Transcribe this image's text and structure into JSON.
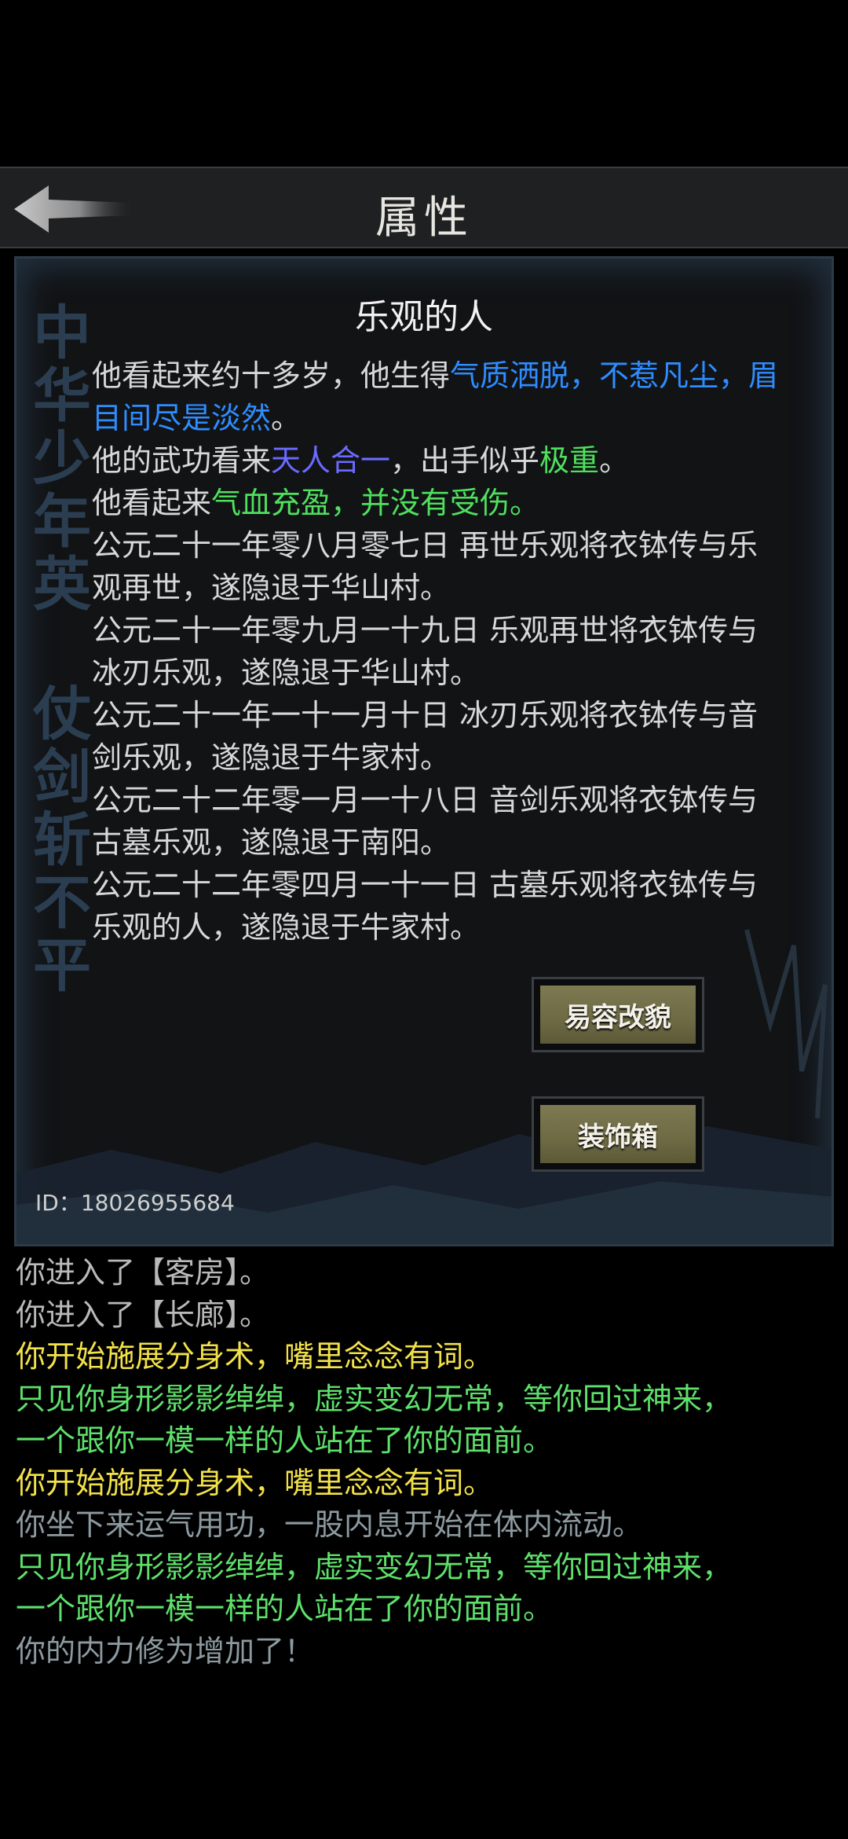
{
  "header": {
    "title": "属性",
    "back_icon": "back-arrow-icon"
  },
  "panel": {
    "calligraphy_left": "中华少年英",
    "calligraphy_right": "仗剑斩不平",
    "character_name": "乐观的人",
    "bio": [
      [
        {
          "text": "他看起来约十多岁，他生得",
          "color": "default"
        },
        {
          "text": "气质洒脱，不惹凡尘，眉目间尽是淡然",
          "color": "blue"
        },
        {
          "text": "。",
          "color": "default"
        }
      ],
      [
        {
          "text": "他的武功看来",
          "color": "default"
        },
        {
          "text": "天人合一",
          "color": "purple"
        },
        {
          "text": "，出手似乎",
          "color": "default"
        },
        {
          "text": "极重",
          "color": "green"
        },
        {
          "text": "。",
          "color": "default"
        }
      ],
      [
        {
          "text": "他看起来",
          "color": "default"
        },
        {
          "text": "气血充盈，并没有受伤。",
          "color": "green"
        }
      ],
      [
        {
          "text": "公元二十一年零八月零七日 再世乐观将衣钵传与乐观再世，遂隐退于华山村。",
          "color": "default"
        }
      ],
      [
        {
          "text": "公元二十一年零九月一十九日 乐观再世将衣钵传与冰刃乐观，遂隐退于华山村。",
          "color": "default"
        }
      ],
      [
        {
          "text": "公元二十一年一十一月十日 冰刃乐观将衣钵传与音剑乐观，遂隐退于牛家村。",
          "color": "default"
        }
      ],
      [
        {
          "text": "公元二十二年零一月一十八日 音剑乐观将衣钵传与古墓乐观，遂隐退于南阳。",
          "color": "default"
        }
      ],
      [
        {
          "text": "公元二十二年零四月一十一日 古墓乐观将衣钵传与乐观的人，遂隐退于牛家村。",
          "color": "default"
        }
      ]
    ],
    "buttons": {
      "disguise": "易容改貌",
      "wardrobe": "装饰箱"
    },
    "player_id": "ID：18026955684"
  },
  "log": [
    {
      "text": "你进入了【客房】。",
      "color": "gray"
    },
    {
      "text": "你进入了【长廊】。",
      "color": "gray"
    },
    {
      "text": "你开始施展分身术，嘴里念念有词。",
      "color": "yellow"
    },
    {
      "text": "只见你身形影影绰绰，虚实变幻无常，等你回过神来，",
      "color": "lgreen"
    },
    {
      "text": "一个跟你一模一样的人站在了你的面前。",
      "color": "lgreen"
    },
    {
      "text": "你开始施展分身术，嘴里念念有词。",
      "color": "yellow"
    },
    {
      "text": "你坐下来运气用功，一股内息开始在体内流动。",
      "color": "mgray"
    },
    {
      "text": "只见你身形影影绰绰，虚实变幻无常，等你回过神来，",
      "color": "lgreen"
    },
    {
      "text": "一个跟你一模一样的人站在了你的面前。",
      "color": "lgreen"
    },
    {
      "text": "你的内力修为增加了！",
      "color": "mgray"
    }
  ]
}
